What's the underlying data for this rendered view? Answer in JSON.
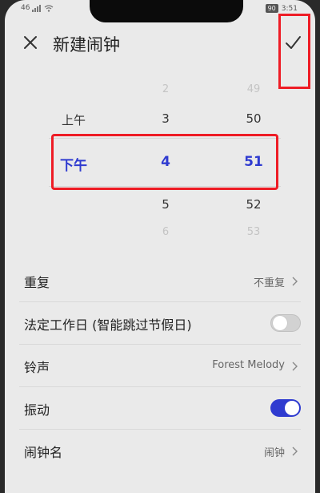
{
  "status_bar": {
    "signal": "46",
    "battery": "90",
    "time": "3:51"
  },
  "header": {
    "close_icon": "close-icon",
    "title": "新建闹钟",
    "confirm_icon": "check-icon"
  },
  "time_picker": {
    "ampm": {
      "above": "上午",
      "selected": "下午"
    },
    "hours": {
      "above2": "2",
      "above1": "3",
      "selected": "4",
      "below1": "5",
      "below2": "6"
    },
    "minutes": {
      "above2": "49",
      "above1": "50",
      "selected": "51",
      "below1": "52",
      "below2": "53"
    }
  },
  "settings": {
    "repeat": {
      "label": "重复",
      "value": "不重复"
    },
    "workday": {
      "label": "法定工作日 (智能跳过节假日)",
      "enabled": false
    },
    "ringtone": {
      "label": "铃声",
      "value": "Forest Melody"
    },
    "vibrate": {
      "label": "振动",
      "enabled": true
    },
    "alarm_name": {
      "label": "闹钟名",
      "value": "闹钟"
    }
  },
  "colors": {
    "accent": "#2f3bd0",
    "annotation": "#ee1c25",
    "background": "#eaeaea"
  }
}
